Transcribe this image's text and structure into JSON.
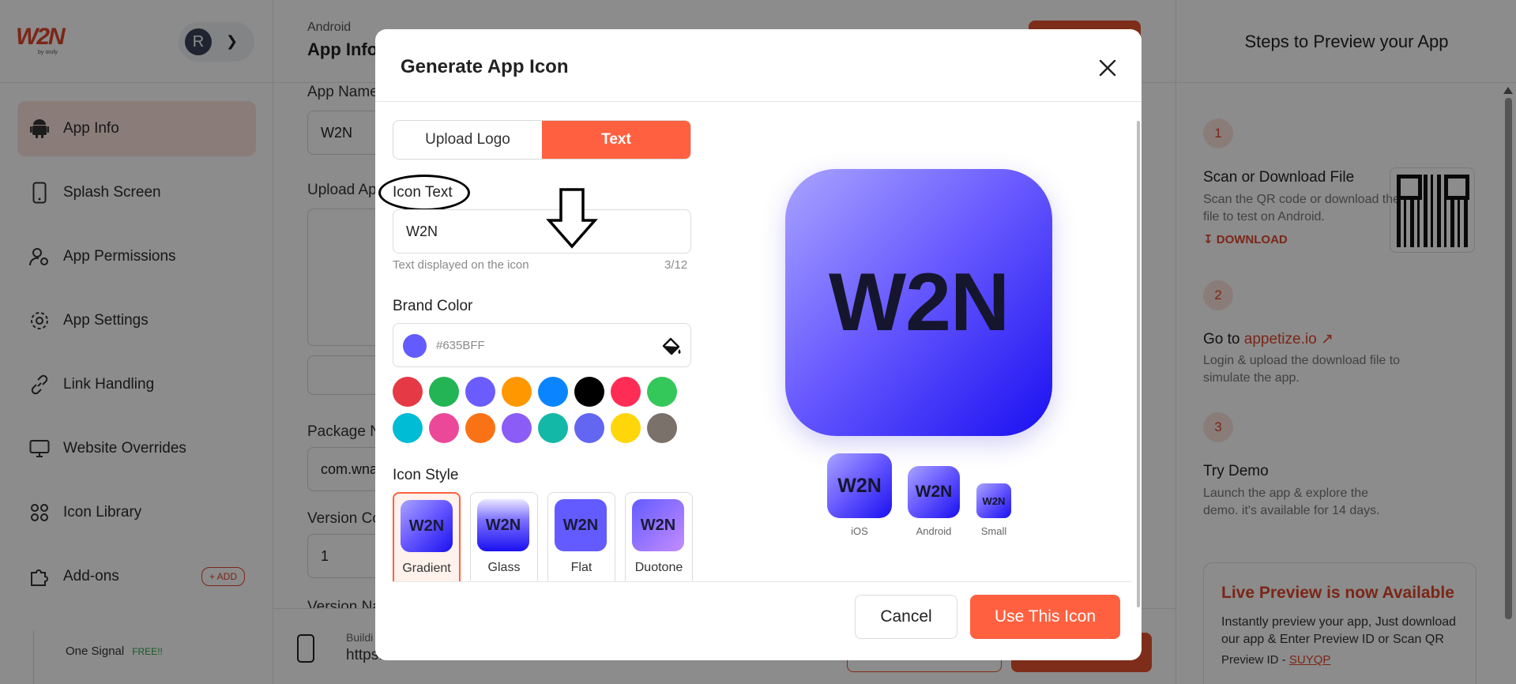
{
  "sidebar": {
    "logo_text": "W2N",
    "logo_by": "by orufy",
    "user_initial": "R",
    "items": [
      {
        "label": "App Info",
        "icon": "android-icon",
        "active": true
      },
      {
        "label": "Splash Screen",
        "icon": "phone-icon"
      },
      {
        "label": "App Permissions",
        "icon": "user-settings-icon"
      },
      {
        "label": "App Settings",
        "icon": "gear-icon"
      },
      {
        "label": "Link Handling",
        "icon": "link-icon"
      },
      {
        "label": "Website Overrides",
        "icon": "monitor-icon"
      },
      {
        "label": "Icon Library",
        "icon": "grid-icon"
      },
      {
        "label": "Add-ons",
        "icon": "puzzle-icon",
        "badge": "+ ADD"
      }
    ],
    "sub_item": {
      "label": "One Signal",
      "badge": "FREE!!"
    }
  },
  "main": {
    "breadcrumb": "Android",
    "title": "App Info",
    "fields": {
      "app_name_label": "App Name",
      "app_name_value": "W2N",
      "upload_label": "Upload Ap",
      "package_label": "Package N",
      "package_value": "com.wna",
      "version_code_label": "Version Co",
      "version_code_value": "1",
      "version_name_label": "Version Na"
    },
    "bottom": {
      "build_label": "Buildi",
      "url": "https://webtonative.com"
    }
  },
  "right_panel": {
    "title": "Steps to Preview your App",
    "steps": [
      {
        "num": "1",
        "title": "Scan or Download File",
        "desc": "Scan the QR code or download the file to test on Android.",
        "link": "DOWNLOAD"
      },
      {
        "num": "2",
        "title_prefix": "Go to ",
        "title_link": "appetize.io",
        "desc": "Login & upload the download file to simulate the app."
      },
      {
        "num": "3",
        "title": "Try Demo",
        "desc": "Launch the app & explore the demo. it's available for 14 days."
      }
    ],
    "live_card": {
      "title": "Live Preview is now Available",
      "desc": "Instantly preview your app, Just download our app & Enter Preview ID or Scan QR",
      "preview_label": "Preview ID - ",
      "preview_id": "SUYQP"
    }
  },
  "modal": {
    "title": "Generate App Icon",
    "tabs": [
      {
        "label": "Upload Logo",
        "active": false
      },
      {
        "label": "Text",
        "active": true
      }
    ],
    "icon_text": {
      "label": "Icon Text",
      "value": "W2N",
      "hint": "Text displayed on the icon",
      "counter": "3/12"
    },
    "brand_color": {
      "label": "Brand Color",
      "value": "#635BFF",
      "palette": [
        "#e53945",
        "#22b455",
        "#6a5cff",
        "#ff9800",
        "#0a84ff",
        "#000000",
        "#ff2d55",
        "#34c759",
        "#00bcd4",
        "#ec4899",
        "#f97316",
        "#8b5cf6",
        "#14b8a6",
        "#6366f1",
        "#ffd60a",
        "#7a716b"
      ]
    },
    "icon_style": {
      "label": "Icon Style",
      "options": [
        {
          "name": "Gradient",
          "selected": true
        },
        {
          "name": "Glass",
          "selected": false
        },
        {
          "name": "Flat",
          "selected": false
        },
        {
          "name": "Duotone",
          "selected": false
        }
      ],
      "tile_text": "W2N"
    },
    "preview": {
      "text": "W2N",
      "sizes": [
        {
          "label": "iOS"
        },
        {
          "label": "Android"
        },
        {
          "label": "Small"
        }
      ]
    },
    "buttons": {
      "cancel": "Cancel",
      "confirm": "Use This Icon"
    },
    "accent_color": "#ff6140"
  }
}
